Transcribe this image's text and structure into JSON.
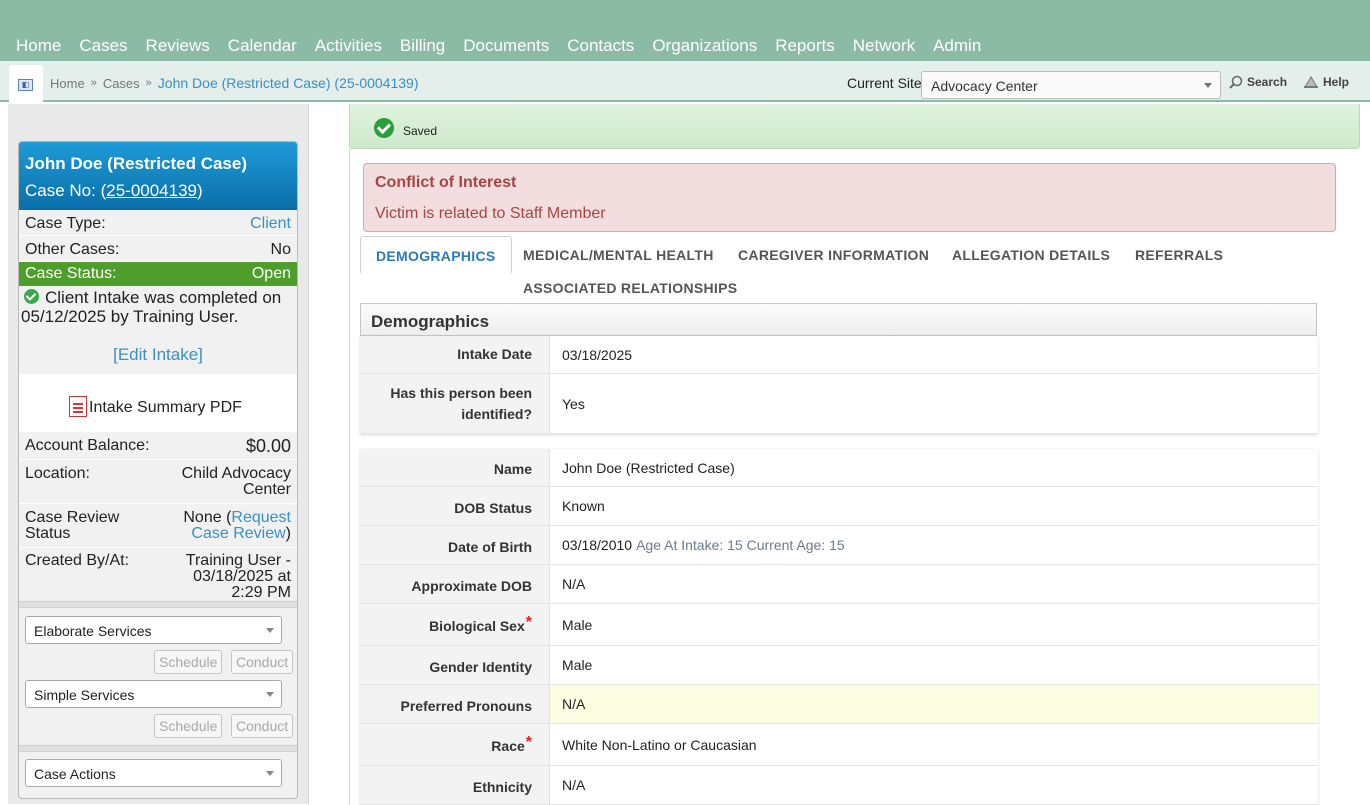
{
  "nav": {
    "items": [
      "Home",
      "Cases",
      "Reviews",
      "Calendar",
      "Activities",
      "Billing",
      "Documents",
      "Contacts",
      "Organizations",
      "Reports",
      "Network",
      "Admin"
    ]
  },
  "breadcrumb": {
    "home": "Home",
    "cases": "Cases",
    "sep": "»",
    "current": "John Doe (Restricted Case) (25-0004139)"
  },
  "site": {
    "label": "Current Site",
    "selected": "Advocacy Center"
  },
  "tools": {
    "search": "Search",
    "help": "Help"
  },
  "case": {
    "title": "John Doe (Restricted Case)",
    "caseno_prefix": "Case No: (",
    "caseno": "25-0004139",
    "caseno_suffix": ")",
    "case_type_label": "Case Type:",
    "case_type": "Client",
    "other_cases_label": "Other Cases:",
    "other_cases": "No",
    "status_label": "Case Status:",
    "status": "Open",
    "intake_note": "Client Intake was completed on 05/12/2025 by Training User.",
    "edit_intake": "[Edit Intake]",
    "pdf_link": "Intake Summary PDF",
    "balance_label": "Account Balance:",
    "balance": "$0.00",
    "location_label": "Location:",
    "location_line1": "Child Advocacy",
    "location_line2": "Center",
    "review_label_line1": "Case Review",
    "review_label_line2": "Status",
    "review_none": "None (",
    "review_link_line1": "Request",
    "review_link_line2": "Case Review",
    "review_close": ")",
    "created_label": "Created By/At:",
    "created_line1": "Training User -",
    "created_line2": "03/18/2025 at",
    "created_line3": "2:29 PM",
    "elaborate_services": "Elaborate Services",
    "simple_services": "Simple Services",
    "case_actions": "Case Actions",
    "schedule": "Schedule",
    "conduct": "Conduct"
  },
  "saved": {
    "text": "Saved"
  },
  "alert": {
    "title": "Conflict of Interest",
    "body": "Victim is related to Staff Member"
  },
  "tabs": [
    "DEMOGRAPHICS",
    "MEDICAL/MENTAL HEALTH",
    "CAREGIVER INFORMATION",
    "ALLEGATION DETAILS",
    "REFERRALS",
    "ASSOCIATED RELATIONSHIPS"
  ],
  "section": {
    "title": "Demographics"
  },
  "fields1": [
    {
      "label": "Intake Date",
      "value": "03/18/2025"
    },
    {
      "label": "Has this person been identified?",
      "value": "Yes"
    }
  ],
  "fields2": [
    {
      "label": "Name",
      "value": "John Doe (Restricted Case)"
    },
    {
      "label": "DOB Status",
      "value": "Known"
    },
    {
      "label": "Date of Birth",
      "value": "03/18/2010",
      "extra": "Age At Intake: 15 Current Age: 15"
    },
    {
      "label": "Approximate DOB",
      "value": "N/A"
    },
    {
      "label": "Biological Sex",
      "value": "Male",
      "required": "*"
    },
    {
      "label": "Gender Identity",
      "value": "Male"
    },
    {
      "label": "Preferred Pronouns",
      "value": "N/A"
    },
    {
      "label": "Race",
      "value": "White Non-Latino or Caucasian",
      "required": "*"
    },
    {
      "label": "Ethnicity",
      "value": "N/A"
    }
  ]
}
